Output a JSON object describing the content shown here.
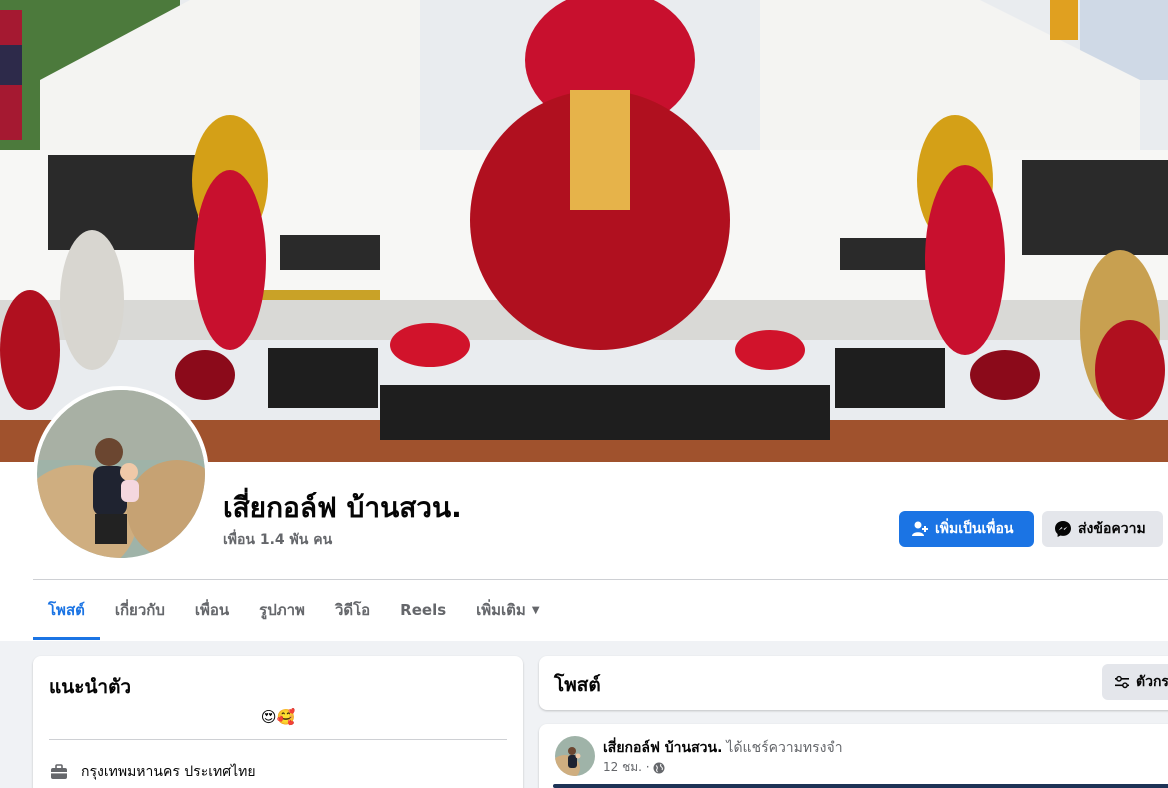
{
  "profile": {
    "name": "เสี่ยกอล์ฟ บ้านสวน.",
    "friends": "เพื่อน 1.4 พัน คน"
  },
  "actions": {
    "add_friend": "เพิ่มเป็นเพื่อน",
    "message": "ส่งข้อความ"
  },
  "tabs": [
    {
      "label": "โพสต์",
      "active": true
    },
    {
      "label": "เกี่ยวกับ"
    },
    {
      "label": "เพื่อน"
    },
    {
      "label": "รูปภาพ"
    },
    {
      "label": "วิดีโอ"
    },
    {
      "label": "Reels"
    },
    {
      "label": "เพิ่มเติม"
    }
  ],
  "intro": {
    "title": "แนะนำตัว",
    "bio": "😍🥰",
    "location": "กรุงเทพมหานคร ประเทศไทย"
  },
  "posts": {
    "title": "โพสต์",
    "filter_label": "ตัวกรอง"
  },
  "post": {
    "author": "เสี่ยกอล์ฟ บ้านสวน.",
    "action": "ได้แชร์ความทรงจำ",
    "time": "12 ชม. ·"
  },
  "colors": {
    "accent": "#1b74e4",
    "background": "#f0f2f5",
    "secondary_text": "#65676b"
  },
  "icons": {
    "add_friend": "person-plus-icon",
    "message": "messenger-icon",
    "tab_more": "caret-down-icon",
    "location": "briefcase-icon",
    "filter": "sliders-icon",
    "audience": "globe-icon"
  }
}
